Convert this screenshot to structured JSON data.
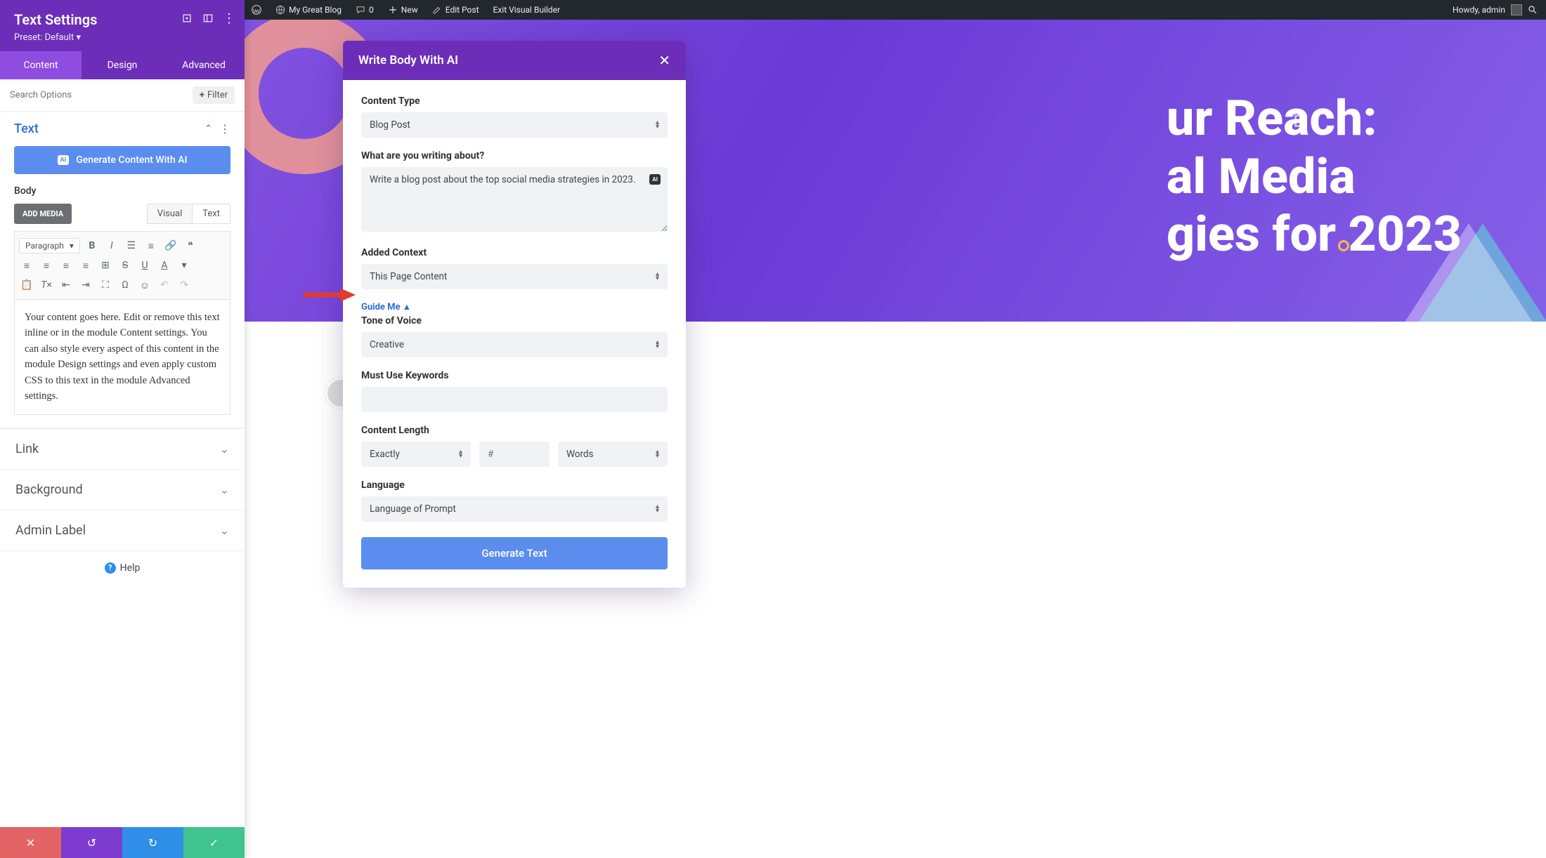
{
  "wp_bar": {
    "site": "My Great Blog",
    "comments": "0",
    "new": "New",
    "edit": "Edit Post",
    "exit": "Exit Visual Builder",
    "howdy": "Howdy, admin"
  },
  "hero": {
    "line1": "ur Reach:",
    "line2": "al Media",
    "line3": "gies for 2023"
  },
  "sidebar": {
    "title": "Text Settings",
    "preset": "Preset: Default",
    "tabs": {
      "content": "Content",
      "design": "Design",
      "advanced": "Advanced"
    },
    "search_placeholder": "Search Options",
    "filter": "Filter",
    "text_section": "Text",
    "generate_btn": "Generate Content With AI",
    "body_label": "Body",
    "add_media": "ADD MEDIA",
    "editor_tabs": {
      "visual": "Visual",
      "text": "Text"
    },
    "format_select": "Paragraph",
    "content_text": "Your content goes here. Edit or remove this text inline or in the module Content settings. You can also style every aspect of this content in the module Design settings and even apply custom CSS to this text in the module Advanced settings.",
    "collapse": {
      "link": "Link",
      "background": "Background",
      "admin": "Admin Label"
    },
    "help": "Help"
  },
  "modal": {
    "title": "Write Body With AI",
    "content_type_label": "Content Type",
    "content_type": "Blog Post",
    "about_label": "What are you writing about?",
    "about_value": "Write a blog post about the top social media strategies in 2023.",
    "context_label": "Added Context",
    "context": "This Page Content",
    "guide": "Guide Me",
    "tone_label": "Tone of Voice",
    "tone": "Creative",
    "keywords_label": "Must Use Keywords",
    "keywords": "",
    "length_label": "Content Length",
    "length_mode": "Exactly",
    "length_num_placeholder": "#",
    "length_unit": "Words",
    "language_label": "Language",
    "language": "Language of Prompt",
    "generate": "Generate Text"
  }
}
